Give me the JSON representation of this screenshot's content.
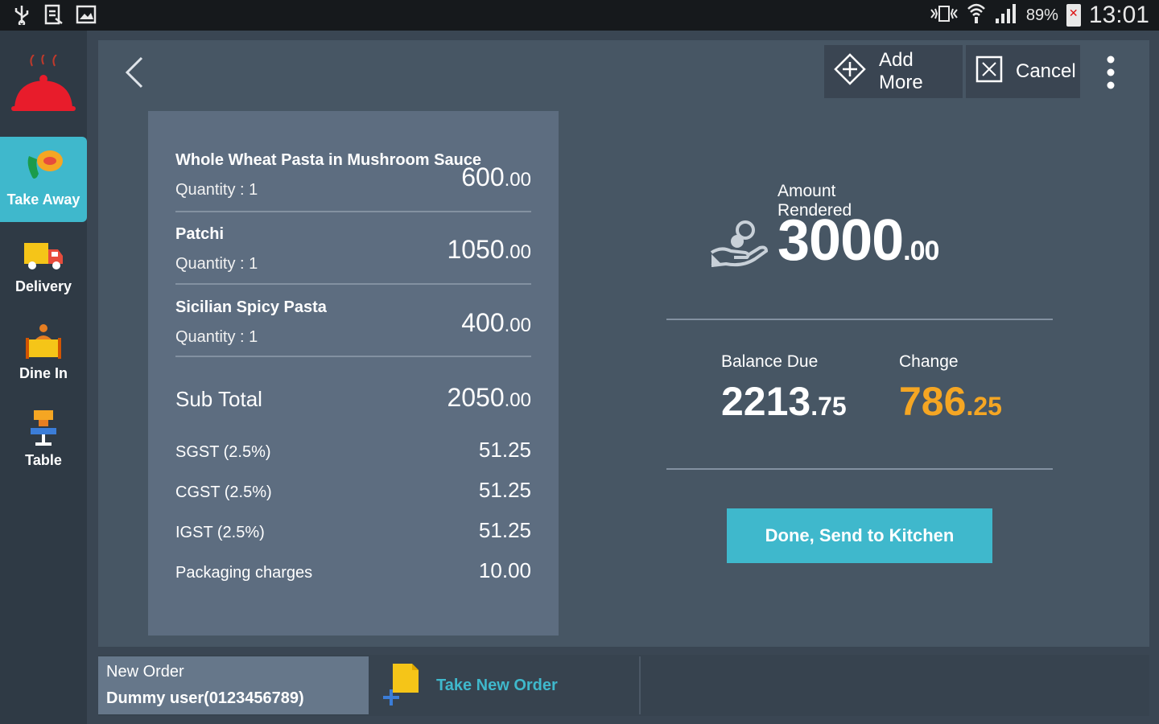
{
  "statusbar": {
    "battery": "89%",
    "time": "13:01"
  },
  "sidebar": {
    "items": [
      {
        "label": "Take Away",
        "active": true
      },
      {
        "label": "Delivery",
        "active": false
      },
      {
        "label": "Dine In",
        "active": false
      },
      {
        "label": "Table",
        "active": false
      }
    ]
  },
  "toolbar": {
    "add_more": "Add More",
    "cancel": "Cancel"
  },
  "order": {
    "items": [
      {
        "name": "Whole Wheat Pasta in Mushroom Sauce",
        "quantity": "Quantity : 1",
        "price_int": "600",
        "price_dec": ".00"
      },
      {
        "name": "Patchi",
        "quantity": "Quantity : 1",
        "price_int": "1050",
        "price_dec": ".00"
      },
      {
        "name": "Sicilian Spicy Pasta",
        "quantity": "Quantity : 1",
        "price_int": "400",
        "price_dec": ".00"
      }
    ],
    "subtotal_label": "Sub Total",
    "subtotal_int": "2050",
    "subtotal_dec": ".00",
    "charges": [
      {
        "label": "SGST (2.5%)",
        "value": "51.25"
      },
      {
        "label": "CGST (2.5%)",
        "value": "51.25"
      },
      {
        "label": "IGST (2.5%)",
        "value": "51.25"
      },
      {
        "label": "Packaging charges",
        "value": "10.00"
      }
    ]
  },
  "payment": {
    "amount_label": "Amount Rendered",
    "amount_int": "3000",
    "amount_dec": ".00",
    "balance_label": "Balance Due",
    "balance_int": "2213",
    "balance_dec": ".75",
    "change_label": "Change",
    "change_int": "786",
    "change_dec": ".25",
    "done_button": "Done, Send to Kitchen",
    "change_color": "#f5a623",
    "accent_color": "#3fb8cc"
  },
  "bottombar": {
    "order_title": "New Order",
    "order_customer": "Dummy user(0123456789)",
    "new_order_label": "Take New Order"
  }
}
